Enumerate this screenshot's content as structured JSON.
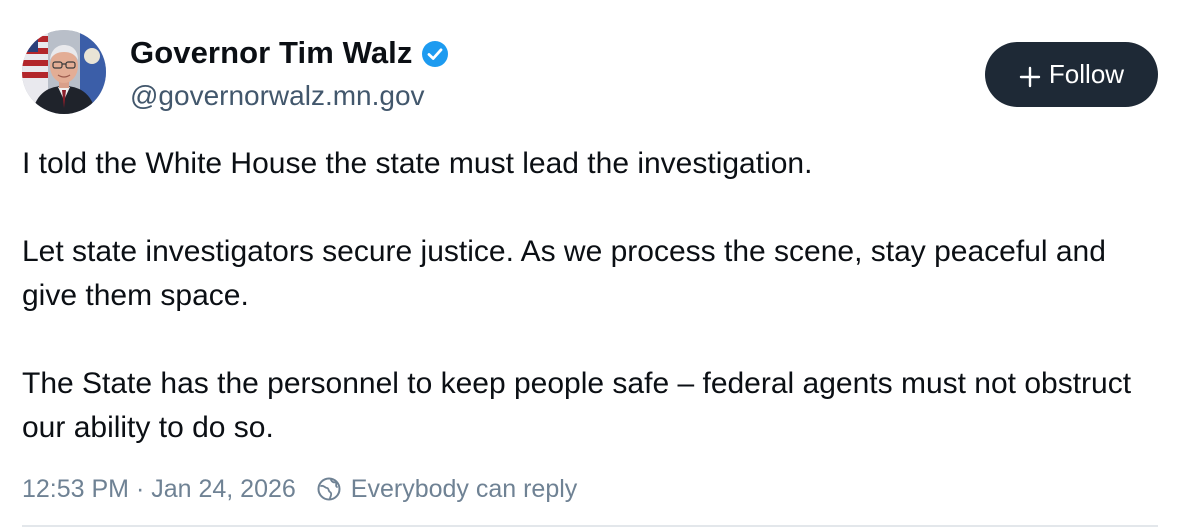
{
  "author": {
    "display_name": "Governor Tim Walz",
    "handle": "@governorwalz.mn.gov",
    "verified": true
  },
  "follow_button": {
    "icon": "plus-icon",
    "label": "Follow"
  },
  "post": {
    "paragraphs": [
      "I told the White House the state must lead the investigation.",
      "Let state investigators secure justice. As we process the scene, stay peaceful and give them space.",
      "The State has the personnel to keep people safe – federal agents must not obstruct our ability to do so."
    ]
  },
  "meta": {
    "timestamp": "12:53 PM · Jan 24, 2026",
    "reply_setting_icon": "globe-icon",
    "reply_setting": "Everybody can reply"
  },
  "colors": {
    "verified_badge": "#1d9bf0",
    "follow_button_bg": "#1e2936",
    "secondary_text": "#6f8294",
    "handle_text": "#42576c"
  }
}
